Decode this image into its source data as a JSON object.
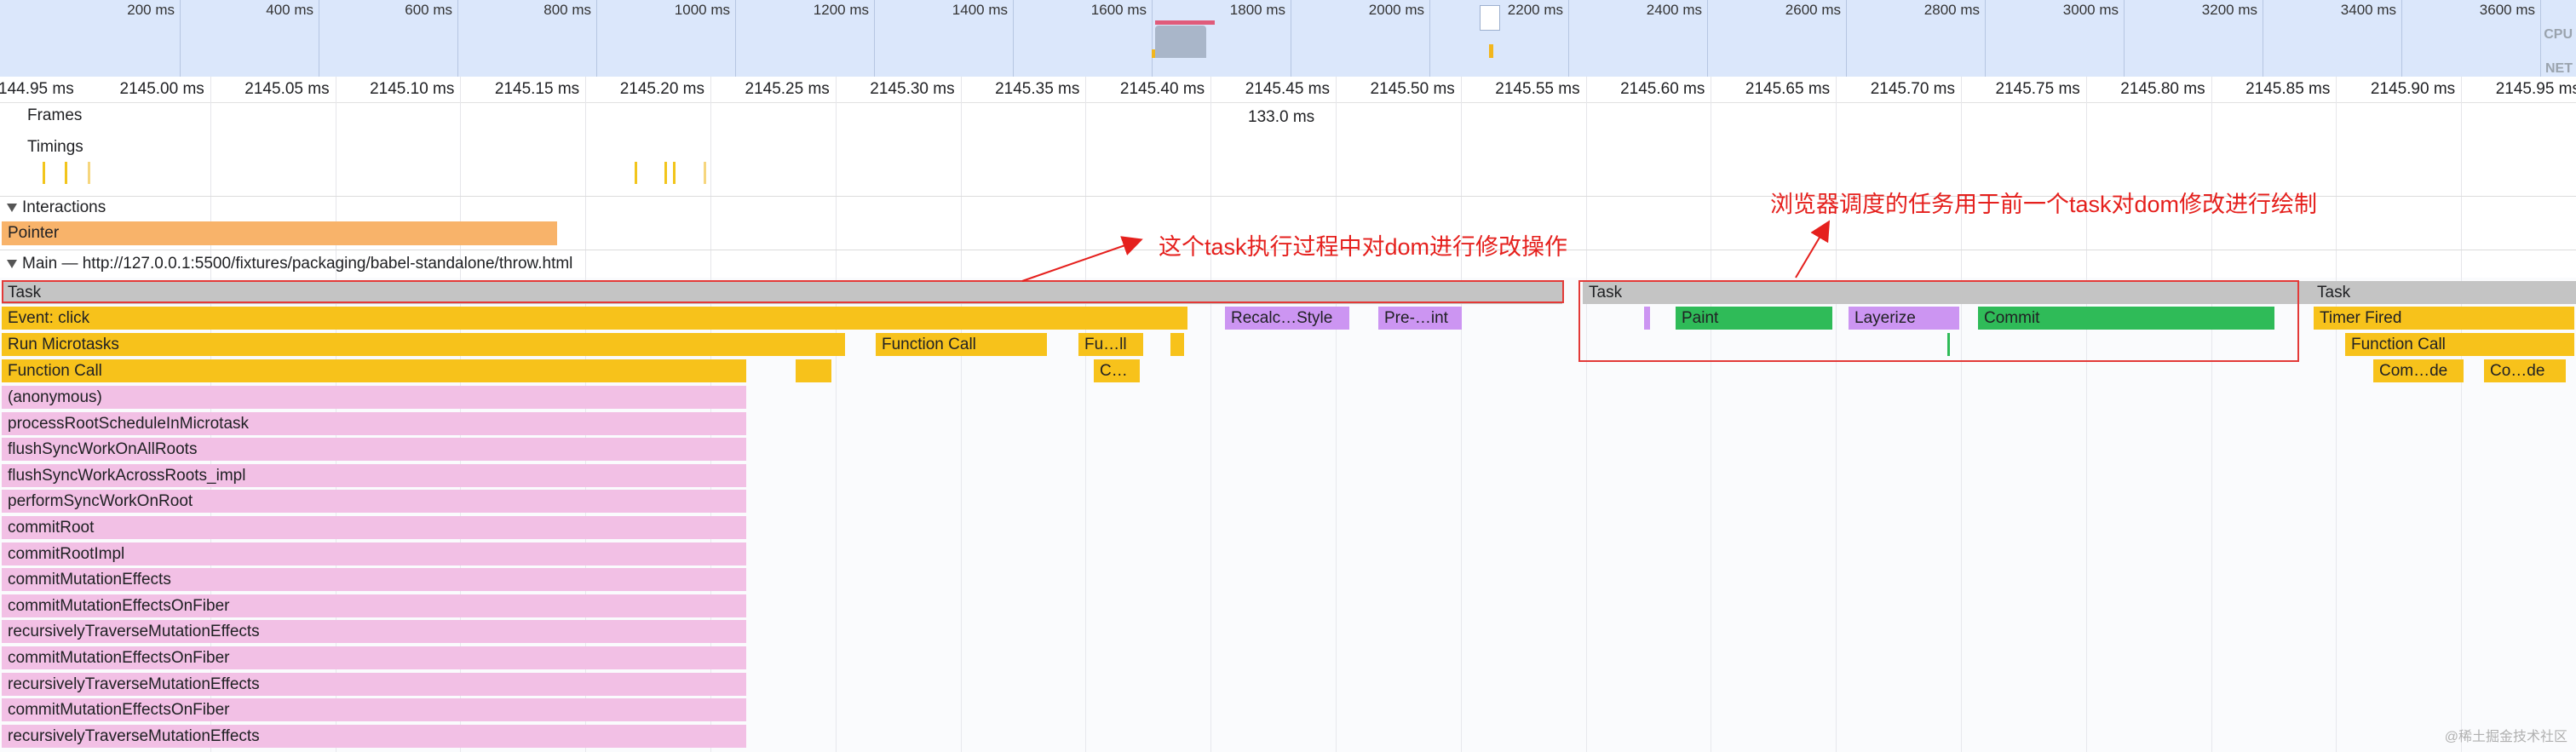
{
  "overview": {
    "labels": [
      "200 ms",
      "400 ms",
      "600 ms",
      "800 ms",
      "1000 ms",
      "1200 ms",
      "1400 ms",
      "1600 ms",
      "1800 ms",
      "2000 ms",
      "2200 ms",
      "2400 ms",
      "2600 ms",
      "2800 ms",
      "3000 ms",
      "3200 ms",
      "3400 ms",
      "3600 ms"
    ],
    "cpu_label": "CPU",
    "net_label": "NET"
  },
  "ruler": {
    "labels": [
      "144.95 ms",
      "2145.00 ms",
      "2145.05 ms",
      "2145.10 ms",
      "2145.15 ms",
      "2145.20 ms",
      "2145.25 ms",
      "2145.30 ms",
      "2145.35 ms",
      "2145.40 ms",
      "2145.45 ms",
      "2145.50 ms",
      "2145.55 ms",
      "2145.60 ms",
      "2145.65 ms",
      "2145.70 ms",
      "2145.75 ms",
      "2145.80 ms",
      "2145.85 ms",
      "2145.90 ms",
      "2145.95 ms"
    ]
  },
  "tracks": {
    "frames": "Frames",
    "frame_duration": "133.0 ms",
    "timings": "Timings",
    "interactions": "Interactions",
    "pointer": "Pointer",
    "main": "Main — http://127.0.0.1:5500/fixtures/packaging/babel-standalone/throw.html"
  },
  "flame": {
    "task_1": "Task",
    "task_2": "Task",
    "task_3": "Task",
    "event_click": "Event: click",
    "recalc_style": "Recalc…Style",
    "pre_paint": "Pre-…int",
    "run_microtasks": "Run Microtasks",
    "function_call_mid": "Function Call",
    "fu_ll": "Fu…ll",
    "function_call": "Function Call",
    "c_short": "C…",
    "paint": "Paint",
    "layerize": "Layerize",
    "commit": "Commit",
    "timer_fired": "Timer Fired",
    "function_call_right": "Function Call",
    "com_de": "Com…de",
    "co_de": "Co…de",
    "stack": [
      "(anonymous)",
      "processRootScheduleInMicrotask",
      "flushSyncWorkOnAllRoots",
      "flushSyncWorkAcrossRoots_impl",
      "performSyncWorkOnRoot",
      "commitRoot",
      "commitRootImpl",
      "commitMutationEffects",
      "commitMutationEffectsOnFiber",
      "recursivelyTraverseMutationEffects",
      "commitMutationEffectsOnFiber",
      "recursivelyTraverseMutationEffects",
      "commitMutationEffectsOnFiber",
      "recursivelyTraverseMutationEffects"
    ]
  },
  "annotations": {
    "left": "这个task执行过程中对dom进行修改操作",
    "right": "浏览器调度的任务用于前一个task对dom修改进行绘制"
  },
  "watermark": "@稀土掘金技术社区"
}
